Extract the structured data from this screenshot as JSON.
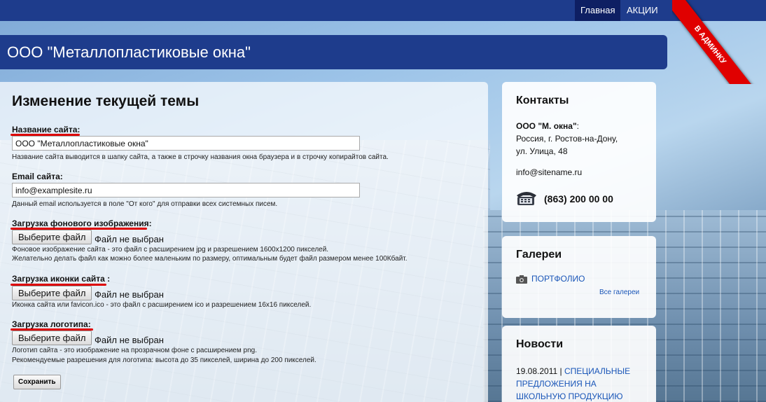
{
  "nav": {
    "home": "Главная",
    "promo": "АКЦИИ",
    "admin_ribbon": "В АДМИНКУ"
  },
  "header": {
    "title": "ООО \"Металлопластиковые окна\""
  },
  "main": {
    "heading": "Изменение текущей темы",
    "site_name": {
      "label": "Название сайта:",
      "value": "ООО \"Металлопластиковые окна\"",
      "help": "Название сайта выводится в шапку сайта, а также в строчку названия окна браузера и в строчку копирайтов сайта."
    },
    "email": {
      "label": "Email сайта:",
      "value": "info@examplesite.ru",
      "help": "Данный email используется в поле \"От кого\" для отправки всех системных писем."
    },
    "background": {
      "label": "Загрузка фонового изображения:",
      "button": "Выберите файл",
      "status": "Файл не выбран",
      "help1": "Фоновое изображение сайта - это файл с расширением jpg и разрешением 1600x1200 пикселей.",
      "help2": "Желательно делать файл как можно более маленьким по размеру, оптимальным будет файл размером менее 100Кбайт."
    },
    "icon": {
      "label": "Загрузка иконки сайта :",
      "button": "Выберите файл",
      "status": "Файл не выбран",
      "help": "Иконка сайта или favicon.ico - это файл с расширением ico и разрешением 16x16 пикселей."
    },
    "logo": {
      "label": "Загрузка логотипа:",
      "button": "Выберите файл",
      "status": "Файл не выбран",
      "help1": "Логотип сайта - это изображение на прозрачном фоне с расширением png.",
      "help2": "Рекомендуемые разрешения для логотипа: высота до 35 пикселей, ширина до 200 пикселей."
    },
    "save_button": "Сохранить"
  },
  "contacts": {
    "heading": "Контакты",
    "company": "ООО \"М. окна\"",
    "company_suffix": ":",
    "address1": "Россия, г. Ростов-на-Дону,",
    "address2": "ул. Улица, 48",
    "email": "info@sitename.ru",
    "phone": "(863) 200 00 00"
  },
  "galleries": {
    "heading": "Галереи",
    "item": "ПОРТФОЛИО",
    "all_link": "Все галереи"
  },
  "news": {
    "heading": "Новости",
    "date": "19.08.2011",
    "separator": " | ",
    "title_line1": "СПЕЦИАЛЬНЫЕ",
    "title_line2": "ПРЕДЛОЖЕНИЯ НА",
    "title_line3": "ШКОЛЬНУЮ ПРОДУКЦИЮ"
  },
  "colors": {
    "nav_bg": "#1e3c8c",
    "nav_active": "#0e1f63",
    "ribbon": "#e00000",
    "link": "#1a56b8",
    "highlight_underline": "#dd0000"
  }
}
